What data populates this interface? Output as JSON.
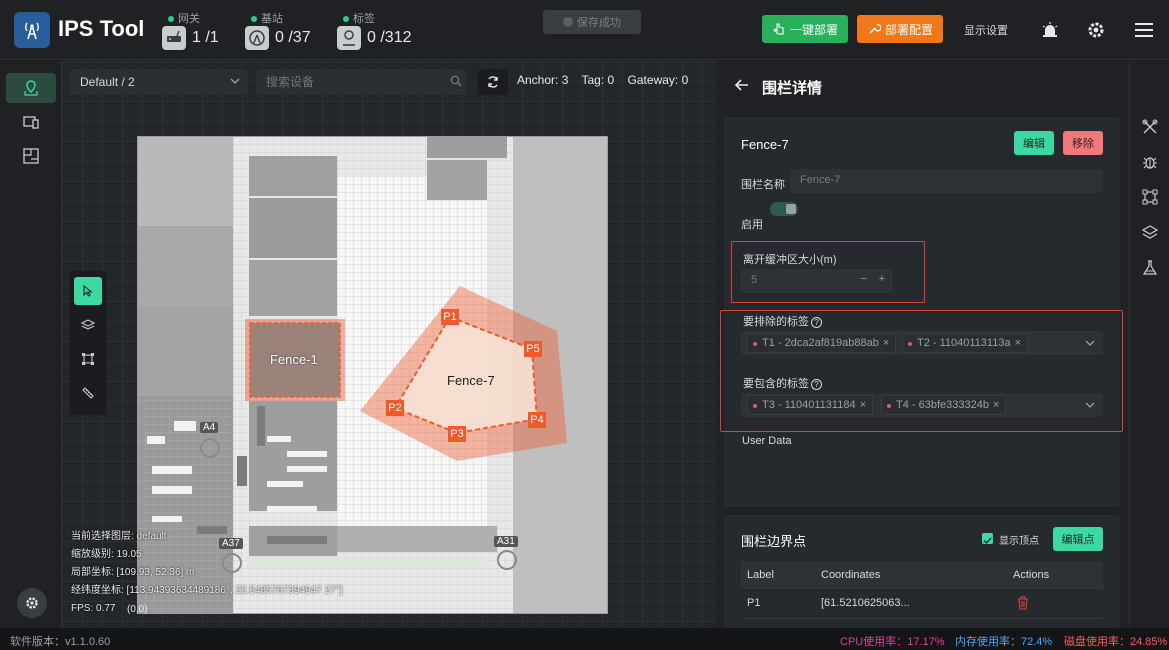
{
  "header": {
    "app_title": "IPS Tool",
    "stats": [
      {
        "label": "网关",
        "value": "1 /1",
        "icon": "router-icon"
      },
      {
        "label": "基站",
        "value": "0 /37",
        "icon": "anchor-icon"
      },
      {
        "label": "标签",
        "value": "0 /312",
        "icon": "tag-user-icon"
      }
    ],
    "save_status": "保存成功",
    "deploy_all": "一键部署",
    "deploy_config": "部署配置",
    "display_settings": "显示设置"
  },
  "map": {
    "layer_select": "Default / 2",
    "search_placeholder": "搜索设备",
    "counts": {
      "anchor": "Anchor: 3",
      "tag": "Tag: 0",
      "gateway": "Gateway: 0"
    },
    "fences": [
      {
        "name": "Fence-1"
      },
      {
        "name": "Fence-7",
        "points": [
          "P1",
          "P2",
          "P3",
          "P4",
          "P5"
        ]
      }
    ],
    "anchors": [
      "A4",
      "A37",
      "A31"
    ],
    "info": {
      "layer": "当前选择图层:  default",
      "zoom": "缩放级别:  19.05",
      "local": "局部坐标:  [109.93, 52.36] m",
      "lnglat": "经纬度坐标:  [113.94393634489186°, 22.5485797394947 27°]",
      "origin": "(0,0)",
      "fps": "FPS:  0.77"
    }
  },
  "panel": {
    "title": "围栏详情",
    "fence_name": "Fence-7",
    "edit": "编辑",
    "remove": "移除",
    "name_label": "围栏名称",
    "name_value": "Fence-7",
    "enable_label": "启用",
    "buffer_label": "离开缓冲区大小(m)",
    "buffer_value": "5",
    "exclude_label": "要排除的标签",
    "exclude_tags": [
      "T1 - 2dca2af819ab88ab",
      "T2 - 11040113113a"
    ],
    "include_label": "要包含的标签",
    "include_tags": [
      "T3 - 110401131184",
      "T4 - 63bfe333324b"
    ],
    "user_data_label": "User Data",
    "boundary_title": "围栏边界点",
    "show_vertices": "显示顶点",
    "edit_points": "编辑点",
    "table_headers": [
      "Label",
      "Coordinates",
      "Actions"
    ],
    "rows": [
      {
        "label": "P1",
        "coord": "[61.5210625063..."
      }
    ]
  },
  "footer": {
    "version": "软件版本：v1.1.0.60",
    "cpu": "CPU使用率：17.17%",
    "mem": "内存使用率：72.4%",
    "disk": "磁盘使用率：24.85%"
  },
  "colors": {
    "accent": "#3cd9a3",
    "deploy_green": "#28b05a",
    "deploy_orange": "#f07818",
    "remove": "#f07a7a",
    "fence": "#ee5a2a",
    "cpu": "#e040a0",
    "mem": "#4aa8ff",
    "disk": "#ff5a5a"
  }
}
